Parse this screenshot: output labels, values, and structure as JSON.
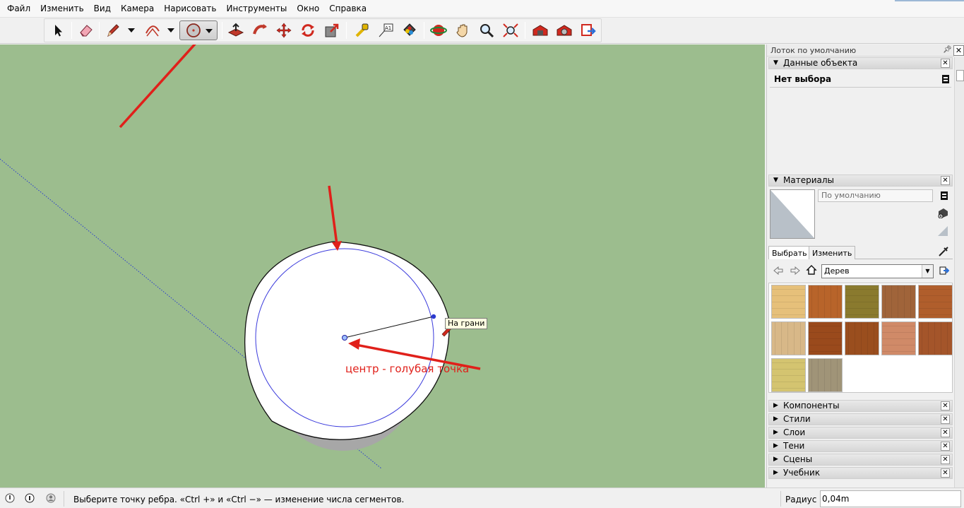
{
  "menu": [
    "Файл",
    "Изменить",
    "Вид",
    "Камера",
    "Нарисовать",
    "Инструменты",
    "Окно",
    "Справка"
  ],
  "toolbar": {
    "active_tool": "circle-tool",
    "tools": [
      "select-tool",
      "eraser-tool",
      "pencil-tool",
      "arc-tool",
      "circle-tool",
      "push-pull-tool",
      "follow-me-tool",
      "move-tool",
      "rotate-tool",
      "scale-tool",
      "tape-measure-tool",
      "text-tool",
      "paint-bucket-tool",
      "orbit-tool",
      "pan-tool",
      "zoom-tool",
      "zoom-extents-tool",
      "warehouse-tool",
      "extension-warehouse-tool",
      "send-to-layout-tool"
    ]
  },
  "viewport": {
    "background": "#9cbd8e",
    "inference_tooltip": "На грани",
    "annotation": "центр - голубая точка",
    "annotation_color": "#e0201a"
  },
  "tray": {
    "title": "Лоток по умолчанию",
    "entity_info": {
      "header": "Данные объекта",
      "selection": "Нет выбора"
    },
    "materials": {
      "header": "Материалы",
      "current": "По умолчанию",
      "tab_select": "Выбрать",
      "tab_edit": "Изменить",
      "library": "Дерев",
      "swatch_colors": [
        "#e6c07a",
        "#b8642a",
        "#8a7a2e",
        "#a0643a",
        "#b05e2c",
        "#d8b888",
        "#9a4a1c",
        "#9a4e1e",
        "#d08a68",
        "#a4552a",
        "#d4c470",
        "#a09478"
      ]
    },
    "collapsed_panels": [
      "Компоненты",
      "Стили",
      "Слои",
      "Тени",
      "Сцены",
      "Учебник"
    ]
  },
  "status": {
    "message": "Выберите точку ребра. «Ctrl +» и «Ctrl −» — изменение числа сегментов.",
    "vcb_label": "Радиус",
    "vcb_value": "0,04m"
  }
}
